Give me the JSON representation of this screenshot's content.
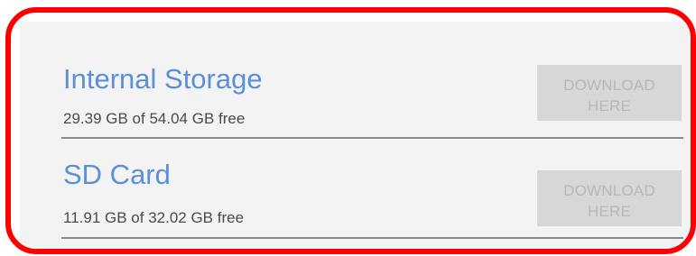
{
  "storage_options": [
    {
      "title": "Internal Storage",
      "subtitle": "29.39 GB of 54.04 GB free",
      "button_line1": "DOWNLOAD",
      "button_line2": "HERE"
    },
    {
      "title": "SD Card",
      "subtitle": "11.91 GB of 32.02 GB free",
      "button_line1": "DOWNLOAD",
      "button_line2": "HERE"
    }
  ],
  "colors": {
    "highlight_border": "#ff0000",
    "title_blue": "#5b8fd6",
    "button_bg": "#d7d7d7",
    "button_text": "#b7b7b7"
  }
}
